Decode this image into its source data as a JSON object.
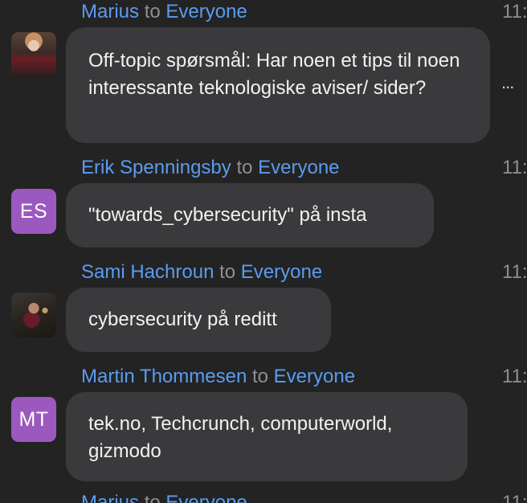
{
  "messages": [
    {
      "sender": "Marius",
      "to": "to",
      "recipient": "Everyone",
      "time": "11:",
      "avatar": {
        "type": "photo",
        "name": "user-photo-icon"
      },
      "text": "Off-topic spørsmål: Har noen et tips til noen interessante teknologiske aviser/ sider?",
      "more_label": "..."
    },
    {
      "sender": "Erik Spenningsby",
      "to": "to",
      "recipient": "Everyone",
      "time": "11:",
      "avatar": {
        "type": "initials",
        "initials": "ES",
        "color": "#9b59c0"
      },
      "text": "\"towards_cybersecurity\" på insta"
    },
    {
      "sender": "Sami Hachroun",
      "to": "to",
      "recipient": "Everyone",
      "time": "11:",
      "avatar": {
        "type": "photo",
        "name": "user-photo-icon"
      },
      "text": "cybersecurity på reditt"
    },
    {
      "sender": "Martin Thommesen",
      "to": "to",
      "recipient": "Everyone",
      "time": "11:",
      "avatar": {
        "type": "initials",
        "initials": "MT",
        "color": "#9b59c0"
      },
      "text": "tek.no, Techcrunch, computerworld, gizmodo"
    },
    {
      "sender": "Marius",
      "to": "to",
      "recipient": "Everyone",
      "time": "11:"
    }
  ],
  "colors": {
    "background": "#232323",
    "bubble": "#3a3a3c",
    "name": "#5b9bf0",
    "meta": "#8e8e93",
    "text": "#f2f2f2"
  }
}
